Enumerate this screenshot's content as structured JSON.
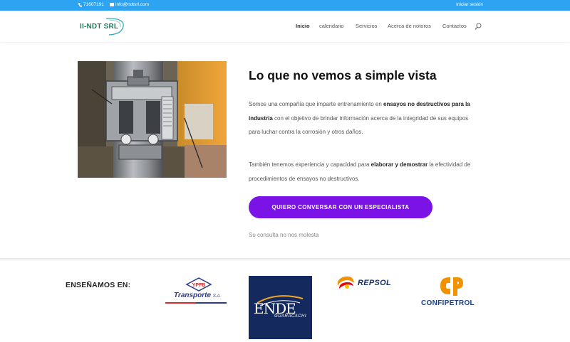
{
  "topbar": {
    "phone": "71607191",
    "email": "info@ndtsrl.com",
    "login": "Iniciar sesión"
  },
  "header": {
    "logo_text": "II-NDT SRL",
    "nav": [
      "Inicio",
      "calendario",
      "Servicios",
      "Acerca de notoros",
      "Contactos"
    ],
    "active_nav": "Inicio"
  },
  "hero": {
    "title": "Lo que no vemos a simple vista",
    "para1": {
      "t1": "Somos una compañía que imparte entrenamiento en ",
      "b1": "ensayos no destructivos para la industria",
      "t2": " con el objetivo de brindar información acerca de la integridad de sus equipos para luchar contra la corrosión y otros daños."
    },
    "para2": {
      "t1": "También tenemos experiencia y capacidad para ",
      "b1": "elaborar y demostrar",
      "t2": " la efectividad de procedimientos de ensayos no destructivos."
    },
    "cta_label": "QUIERO CONVERSAR CON UN ESPECIALISTA",
    "note": "Su consulta no nos molesta"
  },
  "brands": {
    "label": "ENSEÑAMOS EN:",
    "ypfb": {
      "badge": "YPFB",
      "name": "Transporte",
      "suffix": "S.A."
    },
    "ende": {
      "name": "ENDE",
      "sub": "GUARACACHI"
    },
    "repsol": {
      "name": "REPSOL"
    },
    "confipetrol": {
      "name": "CONFIPETROL"
    }
  },
  "colors": {
    "topbar": "#2ea3f2",
    "cta": "#7b13e6",
    "ende_bg": "#142a5e"
  },
  "icons": [
    "phone-icon",
    "mail-icon",
    "search-icon"
  ]
}
